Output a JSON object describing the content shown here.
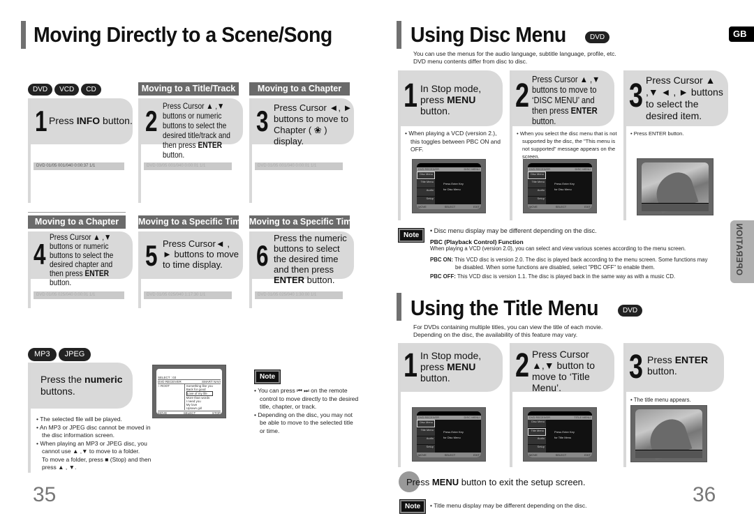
{
  "left_page": {
    "title": "Moving Directly to a Scene/Song",
    "disc_badges": [
      "DVD",
      "VCD",
      "CD"
    ],
    "sections": [
      {
        "header": "",
        "step": "1",
        "text_pre": "Press ",
        "text_bold": "INFO",
        "text_post": " button.",
        "info_bar": "DVD  01/05  001/040  0:00:37  1/1"
      },
      {
        "header": "Moving to a Title/Track",
        "step": "2",
        "text_pre": "Press Cursor ▲ ,▼  buttons or numeric buttons to select the desired title/track and then press ",
        "text_bold": "ENTER",
        "text_post": " button.",
        "info_bar": "DVD  03/05  001/040  0:00:01  1/1"
      },
      {
        "header": "Moving to a Chapter",
        "step": "3",
        "text_pre": "Press Cursor ◄, ► buttons to move to Chapter ( ❀ ) display.",
        "text_bold": "",
        "text_post": "",
        "info_bar": "DVD  01/05  001/040  0:00:01  1/1"
      },
      {
        "header": "Moving to a Chapter",
        "step": "4",
        "text_pre": "Press Cursor ▲ ,▼ buttons or numeric buttons to select the desired chapter and then press ",
        "text_bold": "ENTER",
        "text_post": " button.",
        "info_bar": "DVD  01/05  025/040  0:00:01  1/1"
      },
      {
        "header": "Moving to a Specific Time",
        "step": "5",
        "text_pre": "Press Cursor◄ , ► buttons to move to time display.",
        "text_bold": "",
        "text_post": "",
        "info_bar": "DVD  01/05  025/040  1:17:30  1/1"
      },
      {
        "header": "Moving to a Specific Time",
        "step": "6",
        "text_pre": "Press the numeric buttons to select the desired time and then press ",
        "text_bold": "ENTER",
        "text_post": " button.",
        "info_bar": "DVD  01/05  025/040  1:30:00  1/1"
      }
    ],
    "mp3_badges": [
      "MP3",
      "JPEG"
    ],
    "mp3_step": {
      "text_pre": "Press the ",
      "text_bold": "numeric",
      "text_post": " buttons."
    },
    "mp3_bullets": [
      "The selected file will be played.",
      "An MP3 or JPEG disc cannot be moved in the disc information screen.",
      "When playing an MP3 or JPEG disc, you cannot use ▲ ,▼  to move to a folder.",
      "To move a folder, press ■ (Stop) and then press ▲ , ▼."
    ],
    "mp3_screen": {
      "select": "SELECT :  03",
      "left_title": "DVD RECEIVER",
      "right_title": "SMART NAVI",
      "root": "ROOT",
      "files": [
        "Something like you",
        "Back for good",
        "Love of my life",
        "More than words",
        "I need you",
        "My love",
        "Uptown girl"
      ],
      "selected_index": 2,
      "footer": [
        "MOVE",
        "SELECT",
        "STOP"
      ]
    },
    "note_label": "Note",
    "notes": [
      "You can press ⏮ ⏭  on the remote control to move directly to the desired title, chapter, or track.",
      "Depending on the disc, you may not be able to move to the selected title or time."
    ],
    "page_number": "35"
  },
  "right_page": {
    "lang_tab": "GB",
    "side_tab": "OPERATION",
    "disc_menu": {
      "title": "Using Disc Menu",
      "badge": "DVD",
      "intro": [
        "You can use the menus for the audio language, subtitle language, profile, etc.",
        "DVD menu contents differ from disc to disc."
      ],
      "steps": [
        {
          "num": "1",
          "text_pre": "In Stop mode, press ",
          "text_bold": "MENU",
          "text_post": " button.",
          "bullet": "When playing a VCD (version 2.), this toggles between PBC ON and OFF."
        },
        {
          "num": "2",
          "text_pre": "Press Cursor  ▲ ,▼ buttons to move to ‘DISC MENU’ and then press ",
          "text_bold": "ENTER",
          "text_post": " button.",
          "bullet": "When you select the disc menu that is not supported by the disc, the \"This menu is not supported\" message appears on the screen."
        },
        {
          "num": "3",
          "text_pre": "Press Cursor ▲ ,▼ ◄ , ►  buttons to select the desired item.",
          "text_bold": "",
          "text_post": "",
          "bullet": "Press ENTER button."
        }
      ],
      "screens": [
        {
          "header_left": "DVD RECEIVER",
          "header_right": "DISC MENU",
          "items": [
            "Disc Menu",
            "Title Menu",
            "Audio",
            "Setup"
          ],
          "message": [
            "Press Enter Key",
            "for Disc Menu"
          ],
          "footer": [
            "MOVE",
            "SELECT",
            "EXIT"
          ]
        },
        {
          "header_left": "DVD RECEIVER",
          "header_right": "DISC MENU",
          "items": [
            "Disc Menu",
            "Title Menu",
            "Audio",
            "Setup"
          ],
          "message": [
            "Press Enter Key",
            "for Disc Menu"
          ],
          "footer": [
            "MOVE",
            "SELECT",
            "EXIT"
          ]
        }
      ],
      "note_label": "Note",
      "note": "Disc menu display may be different depending on the disc.",
      "pbc_title": "PBC (Playback Control) Function",
      "pbc_desc": "When playing a VCD (version 2.0), you can select and view various scenes according to the menu screen.",
      "pbc_on_label": "PBC ON:",
      "pbc_on_text": "This VCD disc is version 2.0. The disc is played back according to the menu screen. Some functions may be disabled. When some functions are disabled, select \"PBC OFF\" to enable them.",
      "pbc_off_label": "PBC OFF:",
      "pbc_off_text": "This VCD disc is version 1.1. The disc is played back in the same way as with a music CD."
    },
    "title_menu": {
      "title": "Using the Title Menu",
      "badge": "DVD",
      "intro": [
        "For DVDs containing multiple titles, you can view the title of each movie.",
        "Depending on the disc, the availability of this feature may vary."
      ],
      "steps": [
        {
          "num": "1",
          "text_pre": "In Stop mode, press ",
          "text_bold": "MENU",
          "text_post": " button.",
          "bullet": ""
        },
        {
          "num": "2",
          "text_pre": "Press Cursor ▲,▼ button to move to ‘Title Menu’.",
          "text_bold": "",
          "text_post": "",
          "bullet": ""
        },
        {
          "num": "3",
          "text_pre": "Press ",
          "text_bold": "ENTER",
          "text_post": " button.",
          "bullet": "The title menu appears."
        }
      ],
      "screens": [
        {
          "header_left": "DVD RECEIVER",
          "header_right": "DISC MENU",
          "items": [
            "Disc Menu",
            "Title Menu",
            "Audio",
            "Setup"
          ],
          "message": [
            "Press Enter Key",
            "for Disc Menu"
          ],
          "footer": [
            "MOVE",
            "SELECT",
            "EXIT"
          ]
        },
        {
          "header_left": "DVD RECEIVER",
          "header_right": "TITLE MENU",
          "items": [
            "Disc Menu",
            "Title Menu",
            "Audio",
            "Setup"
          ],
          "message": [
            "Press Enter Key",
            "for Title Menu"
          ],
          "footer": [
            "MOVE",
            "SELECT",
            "EXIT"
          ]
        }
      ],
      "exit_pre": "Press ",
      "exit_bold": "MENU",
      "exit_post": " button to exit the setup screen.",
      "note_label": "Note",
      "note": "Title menu display may be different depending on the disc."
    },
    "page_number": "36"
  }
}
